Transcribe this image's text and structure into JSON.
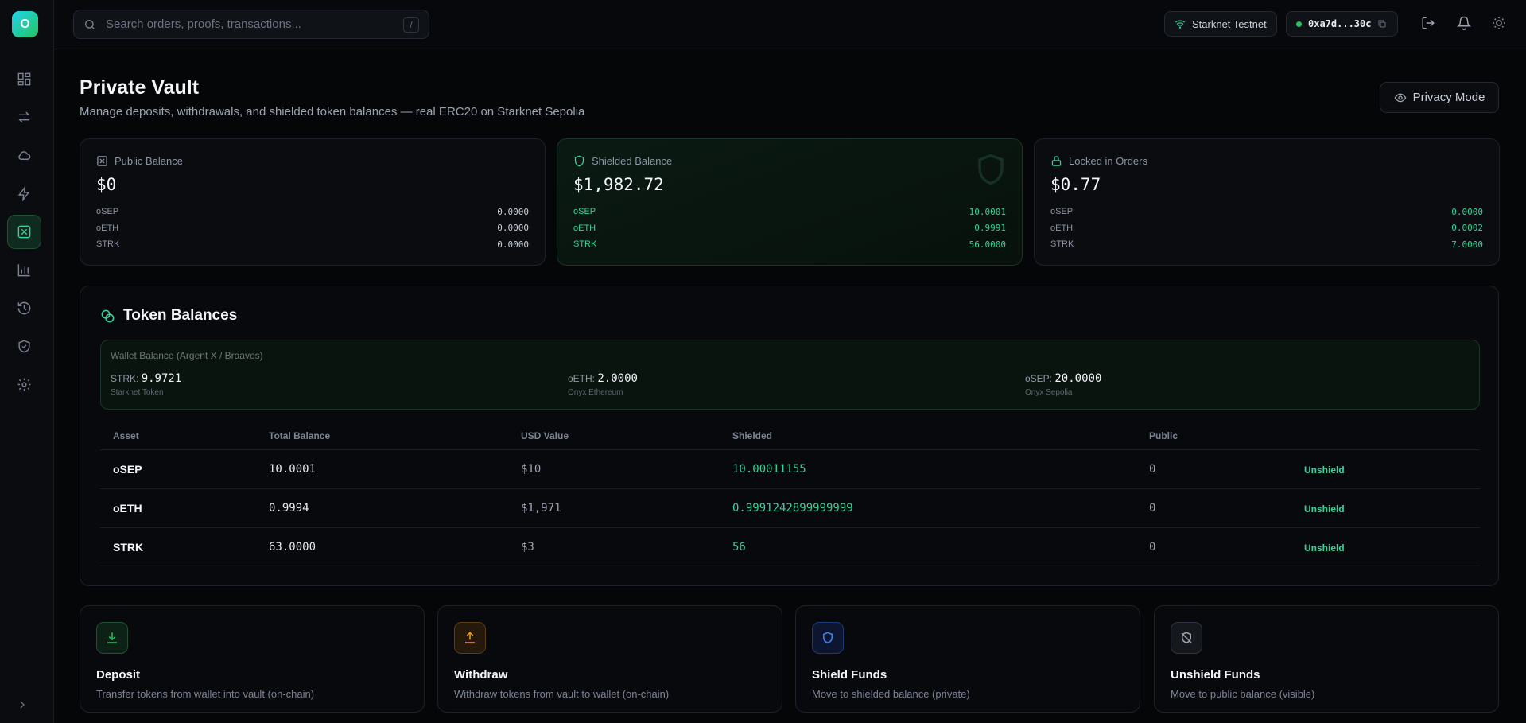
{
  "app": {
    "logo_letter": "O"
  },
  "topbar": {
    "search_placeholder": "Search orders, proofs, transactions...",
    "search_shortcut": "/",
    "network": "Starknet Testnet",
    "wallet_address": "0xa7d...30c"
  },
  "header": {
    "title": "Private Vault",
    "subtitle": "Manage deposits, withdrawals, and shielded token balances — real ERC20 on Starknet Sepolia",
    "privacy_button": "Privacy Mode"
  },
  "cards": [
    {
      "label": "Public Balance",
      "amount": "$0",
      "rows": [
        {
          "token": "oSEP",
          "value": "0.0000"
        },
        {
          "token": "oETH",
          "value": "0.0000"
        },
        {
          "token": "STRK",
          "value": "0.0000"
        }
      ]
    },
    {
      "label": "Shielded Balance",
      "amount": "$1,982.72",
      "rows": [
        {
          "token": "oSEP",
          "value": "10.0001"
        },
        {
          "token": "oETH",
          "value": "0.9991"
        },
        {
          "token": "STRK",
          "value": "56.0000"
        }
      ]
    },
    {
      "label": "Locked in Orders",
      "amount": "$0.77",
      "rows": [
        {
          "token": "oSEP",
          "value": "0.0000"
        },
        {
          "token": "oETH",
          "value": "0.0002"
        },
        {
          "token": "STRK",
          "value": "7.0000"
        }
      ]
    }
  ],
  "token_balances": {
    "title": "Token Balances",
    "wallet_box_title": "Wallet Balance (Argent X / Braavos)",
    "wallet_items": [
      {
        "symbol": "STRK:",
        "amount": "9.9721",
        "name": "Starknet Token"
      },
      {
        "symbol": "oETH:",
        "amount": "2.0000",
        "name": "Onyx Ethereum"
      },
      {
        "symbol": "oSEP:",
        "amount": "20.0000",
        "name": "Onyx Sepolia"
      }
    ],
    "columns": [
      "Asset",
      "Total Balance",
      "USD Value",
      "Shielded",
      "Public"
    ],
    "rows": [
      {
        "asset": "oSEP",
        "total": "10.0001",
        "usd": "$10",
        "shielded": "10.00011155",
        "public": "0",
        "action": "Unshield"
      },
      {
        "asset": "oETH",
        "total": "0.9994",
        "usd": "$1,971",
        "shielded": "0.9991242899999999",
        "public": "0",
        "action": "Unshield"
      },
      {
        "asset": "STRK",
        "total": "63.0000",
        "usd": "$3",
        "shielded": "56",
        "public": "0",
        "action": "Unshield"
      }
    ]
  },
  "actions": [
    {
      "title": "Deposit",
      "desc": "Transfer tokens from wallet into vault (on-chain)",
      "icon": "download-icon",
      "color": "#22c55e"
    },
    {
      "title": "Withdraw",
      "desc": "Withdraw tokens from vault to wallet (on-chain)",
      "icon": "upload-icon",
      "color": "#f59e0b"
    },
    {
      "title": "Shield Funds",
      "desc": "Move to shielded balance (private)",
      "icon": "shield-icon",
      "color": "#3b82f6"
    },
    {
      "title": "Unshield Funds",
      "desc": "Move to public balance (visible)",
      "icon": "shield-off-icon",
      "color": "#9aa3af"
    }
  ]
}
